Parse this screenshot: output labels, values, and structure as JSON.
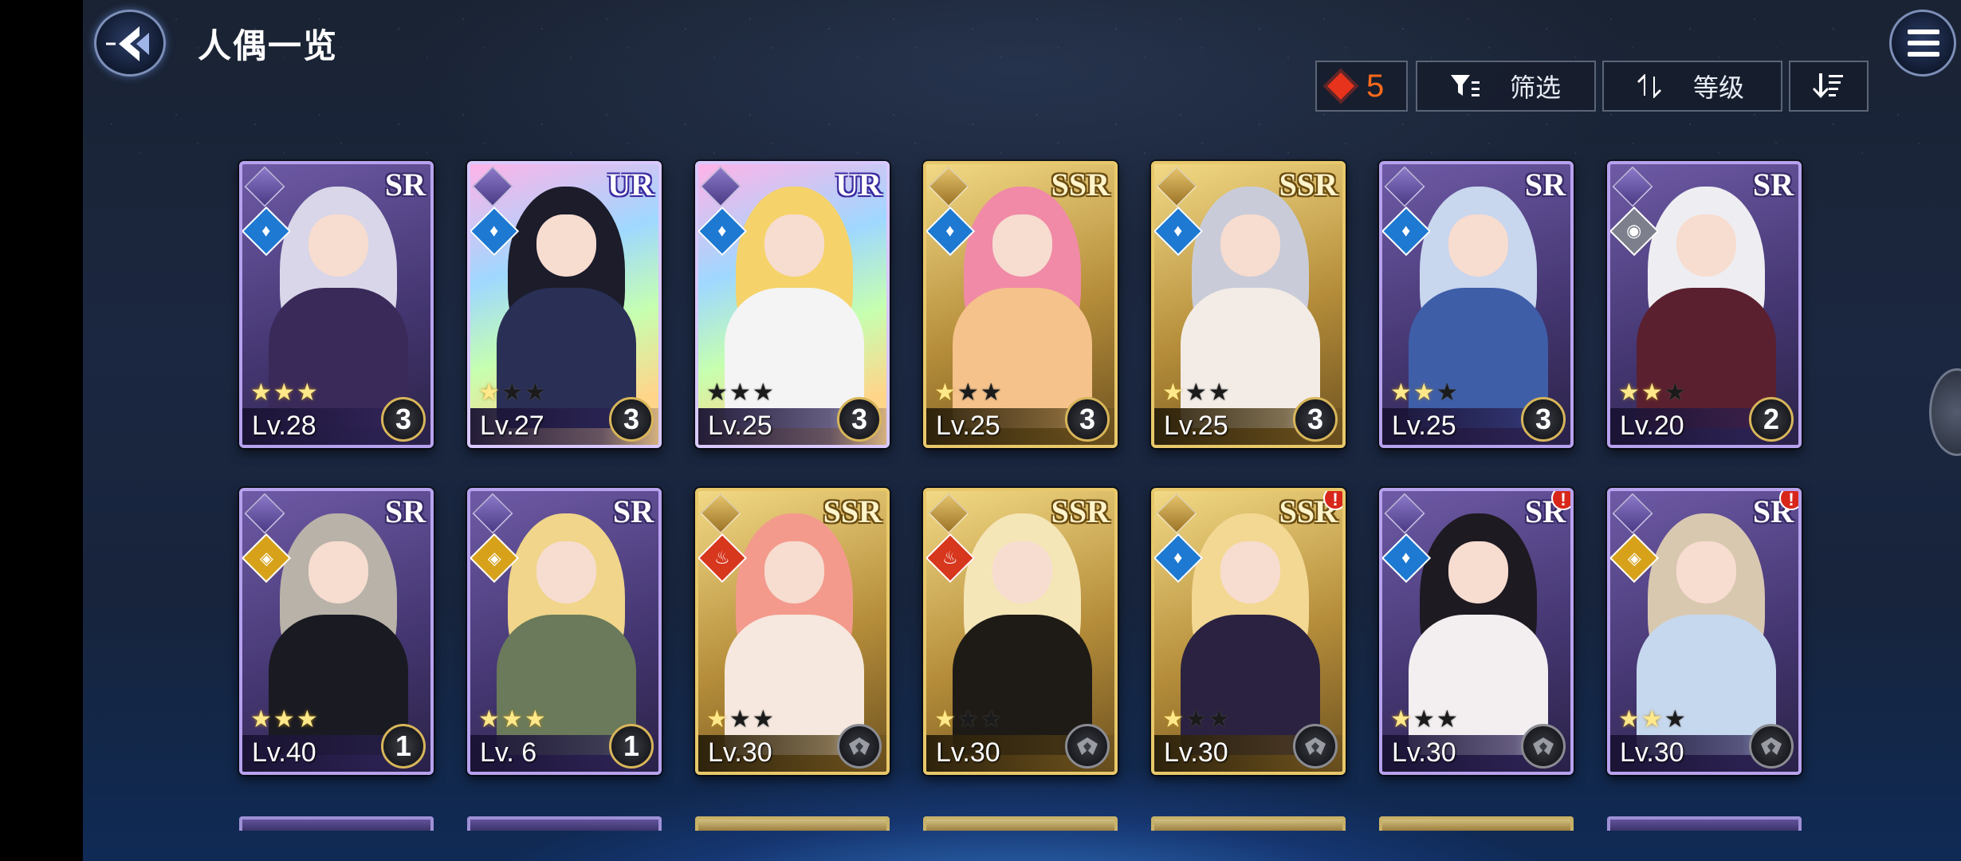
{
  "header": {
    "title": "人偶一览"
  },
  "toolbar": {
    "currency_count": "5",
    "filter_label": "筛选",
    "sort_label": "等级"
  },
  "colors": {
    "accent_currency": "#ff6a1a",
    "sr_frame": "#b7a2ee",
    "ssr_frame": "#e8c86a",
    "ur_frame": "#d9c9ff"
  },
  "cards": [
    {
      "rarity": "SR",
      "element": "water",
      "level": "Lv.28",
      "stars": 3,
      "max_stars": 3,
      "bond": "3",
      "alert": false,
      "hair": "#d8d6e8",
      "outfit": "#3a2a5a"
    },
    {
      "rarity": "UR",
      "element": "water",
      "level": "Lv.27",
      "stars": 1,
      "max_stars": 3,
      "bond": "3",
      "alert": false,
      "hair": "#1c1c2a",
      "outfit": "#2a2f55"
    },
    {
      "rarity": "UR",
      "element": "water",
      "level": "Lv.25",
      "stars": 0,
      "max_stars": 3,
      "bond": "3",
      "alert": false,
      "hair": "#f5d36a",
      "outfit": "#f4f4f4"
    },
    {
      "rarity": "SSR",
      "element": "water",
      "level": "Lv.25",
      "stars": 1,
      "max_stars": 3,
      "bond": "3",
      "alert": false,
      "hair": "#f08aa6",
      "outfit": "#f4c28a"
    },
    {
      "rarity": "SSR",
      "element": "water",
      "level": "Lv.25",
      "stars": 1,
      "max_stars": 3,
      "bond": "3",
      "alert": false,
      "hair": "#c9ccd8",
      "outfit": "#f3ece6"
    },
    {
      "rarity": "SR",
      "element": "water",
      "level": "Lv.25",
      "stars": 2,
      "max_stars": 3,
      "bond": "3",
      "alert": false,
      "hair": "#c8d6ee",
      "outfit": "#3e5ea8"
    },
    {
      "rarity": "SR",
      "element": "dark",
      "level": "Lv.20",
      "stars": 2,
      "max_stars": 3,
      "bond": "2",
      "alert": false,
      "hair": "#eeeef2",
      "outfit": "#5a2030"
    },
    {
      "rarity": "SR",
      "element": "light",
      "level": "Lv.40",
      "stars": 3,
      "max_stars": 3,
      "bond": "1",
      "alert": false,
      "hair": "#b8b2a8",
      "outfit": "#1a1a22"
    },
    {
      "rarity": "SR",
      "element": "light",
      "level": "Lv. 6",
      "stars": 3,
      "max_stars": 3,
      "bond": "1",
      "alert": false,
      "hair": "#f0d58a",
      "outfit": "#6a7a5a"
    },
    {
      "rarity": "SSR",
      "element": "fire",
      "level": "Lv.30",
      "stars": 1,
      "max_stars": 3,
      "bond": "",
      "alert": false,
      "hair": "#f39a8c",
      "outfit": "#f6e8de"
    },
    {
      "rarity": "SSR",
      "element": "fire",
      "level": "Lv.30",
      "stars": 1,
      "max_stars": 3,
      "bond": "",
      "alert": false,
      "hair": "#f5e6b8",
      "outfit": "#1e1a16"
    },
    {
      "rarity": "SSR",
      "element": "water",
      "level": "Lv.30",
      "stars": 1,
      "max_stars": 3,
      "bond": "",
      "alert": true,
      "hair": "#f3d894",
      "outfit": "#2a2240"
    },
    {
      "rarity": "SR",
      "element": "water",
      "level": "Lv.30",
      "stars": 1,
      "max_stars": 3,
      "bond": "",
      "alert": true,
      "hair": "#1e1a22",
      "outfit": "#f3eef0"
    },
    {
      "rarity": "SR",
      "element": "light",
      "level": "Lv.30",
      "stars": 2,
      "max_stars": 3,
      "bond": "",
      "alert": true,
      "hair": "#d9c8b0",
      "outfit": "#c6d8ee"
    }
  ],
  "peek_row": [
    {
      "rarity": "SR",
      "alert": true
    },
    {
      "rarity": "SR",
      "alert": false
    },
    {
      "rarity": "SSR",
      "alert": true
    },
    {
      "rarity": "SSR",
      "alert": false
    },
    {
      "rarity": "SSR",
      "alert": false
    },
    {
      "rarity": "SSR",
      "alert": false
    },
    {
      "rarity": "SR",
      "alert": false
    }
  ]
}
